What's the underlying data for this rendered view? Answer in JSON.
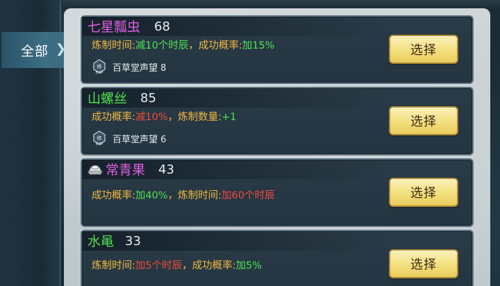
{
  "side_tab": {
    "label": "全部"
  },
  "items": [
    {
      "name": "七星瓢虫",
      "name_color": "#e05ee0",
      "level": "68",
      "effect": [
        {
          "text": "炼制时间:",
          "tone": "label"
        },
        {
          "text": "减10个时辰",
          "tone": "good"
        },
        {
          "text": "，成功概率:",
          "tone": "label"
        },
        {
          "text": "加15%",
          "tone": "good"
        }
      ],
      "reputation": "百草堂声望 8",
      "button": "选择"
    },
    {
      "name": "山螺丝",
      "name_color": "#4fe04f",
      "level": "85",
      "effect": [
        {
          "text": "成功概率:",
          "tone": "label"
        },
        {
          "text": "减10%",
          "tone": "bad"
        },
        {
          "text": "，炼制数量:",
          "tone": "label"
        },
        {
          "text": "+1",
          "tone": "good"
        }
      ],
      "reputation": "百草堂声望 6",
      "button": "选择"
    },
    {
      "name": "常青果",
      "name_color": "#e05ee0",
      "level": "43",
      "effect": [
        {
          "text": "成功概率:",
          "tone": "label"
        },
        {
          "text": "加40%",
          "tone": "good"
        },
        {
          "text": "，炼制时间:",
          "tone": "label"
        },
        {
          "text": "加60个时辰",
          "tone": "bad"
        }
      ],
      "reputation": "",
      "button": "选择"
    },
    {
      "name": "水黾",
      "name_color": "#4fe04f",
      "level": "33",
      "effect": [
        {
          "text": "炼制时间:",
          "tone": "label"
        },
        {
          "text": "加5个时辰",
          "tone": "bad"
        },
        {
          "text": "，成功概率:",
          "tone": "label"
        },
        {
          "text": "加5%",
          "tone": "good"
        }
      ],
      "reputation": "",
      "button": "选择"
    }
  ],
  "icons": {
    "reputation": "exp-badge-icon",
    "item3": "silver-ingot-icon"
  }
}
